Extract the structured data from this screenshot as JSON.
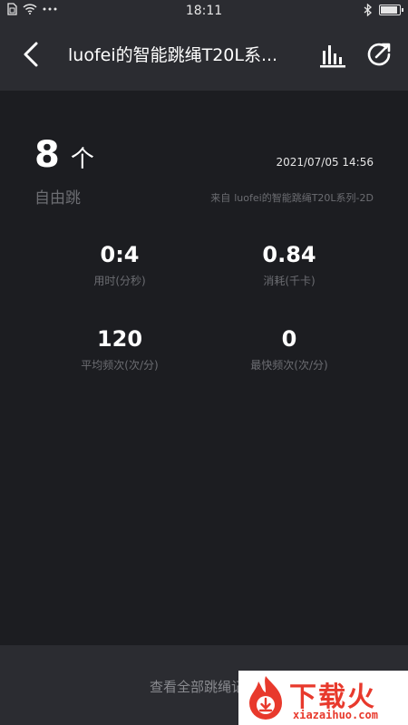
{
  "status_bar": {
    "time": "18:11",
    "icons": [
      "sim-icon",
      "wifi-icon",
      "more-icon",
      "bluetooth-icon",
      "battery-icon"
    ]
  },
  "nav": {
    "title": "luofei的智能跳绳T20L系...",
    "back_icon": "chevron-left-icon",
    "chart_icon": "bar-chart-icon",
    "share_icon": "share-icon"
  },
  "summary": {
    "count": "8",
    "unit": "个",
    "mode": "自由跳",
    "datetime": "2021/07/05 14:56",
    "source_prefix": "来自",
    "source_device": "luofei的智能跳绳T20L系列-2D"
  },
  "stats": [
    {
      "value": "0:4",
      "label": "用时(分秒)"
    },
    {
      "value": "0.84",
      "label": "消耗(千卡)"
    },
    {
      "value": "120",
      "label": "平均频次(次/分)"
    },
    {
      "value": "0",
      "label": "最快频次(次/分)"
    }
  ],
  "footer": {
    "link": "查看全部跳绳记录"
  },
  "watermark": {
    "text": "下载火",
    "sub": "xiazaihuo.com"
  },
  "colors": {
    "background": "#1c1d21",
    "bar": "#2b2c31",
    "muted": "#6c6d72",
    "watermark_red": "#e8392c"
  }
}
